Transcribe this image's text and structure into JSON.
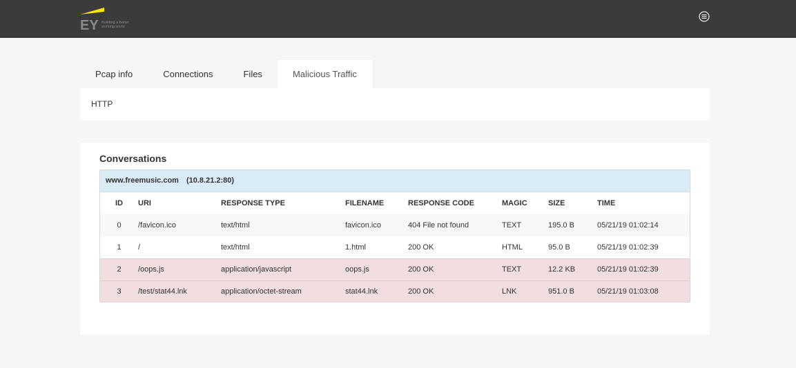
{
  "header": {
    "logo_text": "EY",
    "logo_tagline": "Building a better working world",
    "menu_icon": "menu-circle-icon",
    "colors": {
      "bar": "#3b3b3b",
      "brand_yellow": "#ffe600"
    }
  },
  "tabs": [
    {
      "label": "Pcap info",
      "active": false
    },
    {
      "label": "Connections",
      "active": false
    },
    {
      "label": "Files",
      "active": false
    },
    {
      "label": "Malicious Traffic",
      "active": true
    }
  ],
  "subnav": {
    "label": "HTTP"
  },
  "conversations": {
    "title": "Conversations",
    "host": "www.freemusic.com",
    "ip": "(10.8.21.2:80)",
    "columns": {
      "id": "ID",
      "uri": "URI",
      "response_type": "RESPONSE TYPE",
      "filename": "FILENAME",
      "response_code": "RESPONSE CODE",
      "magic": "MAGIC",
      "size": "SIZE",
      "time": "TIME"
    },
    "rows": [
      {
        "id": "0",
        "uri": "/favicon.ico",
        "response_type": "text/html",
        "filename": "favicon.ico",
        "response_code": "404 File not found",
        "magic": "TEXT",
        "size": "195.0 B",
        "time": "05/21/19 01:02:14",
        "malicious": false
      },
      {
        "id": "1",
        "uri": "/",
        "response_type": "text/html",
        "filename": "1.html",
        "response_code": "200 OK",
        "magic": "HTML",
        "size": "95.0 B",
        "time": "05/21/19 01:02:39",
        "malicious": false
      },
      {
        "id": "2",
        "uri": "/oops.js",
        "response_type": "application/javascript",
        "filename": "oops.js",
        "response_code": "200 OK",
        "magic": "TEXT",
        "size": "12.2 KB",
        "time": "05/21/19 01:02:39",
        "malicious": true
      },
      {
        "id": "3",
        "uri": "/test/stat44.lnk",
        "response_type": "application/octet-stream",
        "filename": "stat44.lnk",
        "response_code": "200 OK",
        "magic": "LNK",
        "size": "951.0 B",
        "time": "05/21/19 01:03:08",
        "malicious": true
      }
    ],
    "colors": {
      "header_bg": "#d9ebf5",
      "malicious_bg": "#f2dede"
    }
  }
}
